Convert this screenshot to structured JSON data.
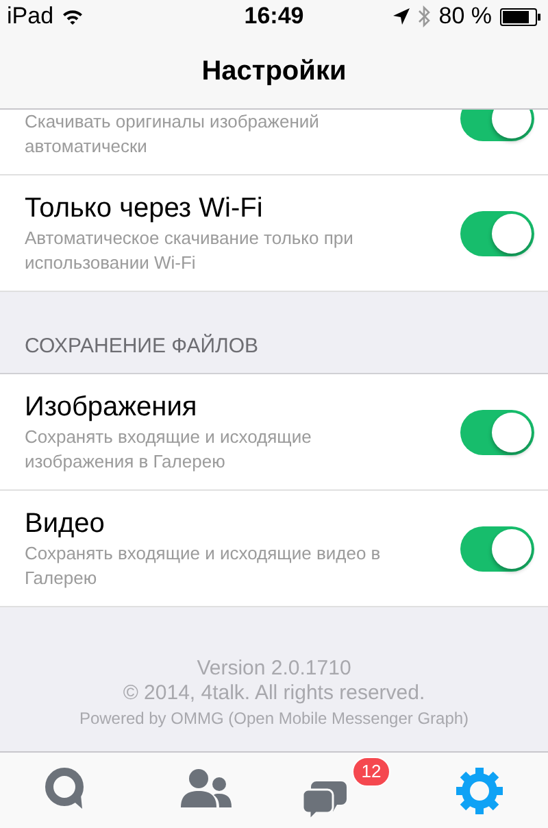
{
  "status_bar": {
    "device": "iPad",
    "time": "16:49",
    "battery": "80 %"
  },
  "nav_bar": {
    "title": "Настройки"
  },
  "settings": [
    {
      "kind": "partial",
      "subtitle": "Скачивать оригиналы изображений автоматически",
      "on": true
    },
    {
      "kind": "row",
      "title": "Только через Wi-Fi",
      "subtitle": "Автоматическое скачивание только при использовании Wi-Fi",
      "on": true
    },
    {
      "kind": "header",
      "title": "СОХРАНЕНИЕ ФАЙЛОВ"
    },
    {
      "kind": "row",
      "title": "Изображения",
      "subtitle": "Сохранять входящие и исходящие изображения в Галерею",
      "on": true
    },
    {
      "kind": "row",
      "title": "Видео",
      "subtitle": "Сохранять входящие и исходящие видео в Галерею",
      "on": true
    }
  ],
  "footer": [
    "Version 2.0.1710",
    "© 2014, 4talk. All rights reserved.",
    "Powered by OMMG (Open Mobile Messenger Graph)"
  ],
  "tab_bar": [
    {
      "kind": "chat",
      "selected": false
    },
    {
      "kind": "contacts",
      "selected": false
    },
    {
      "kind": "conversations",
      "selected": false,
      "badge": "12"
    },
    {
      "kind": "settings",
      "selected": true
    }
  ]
}
